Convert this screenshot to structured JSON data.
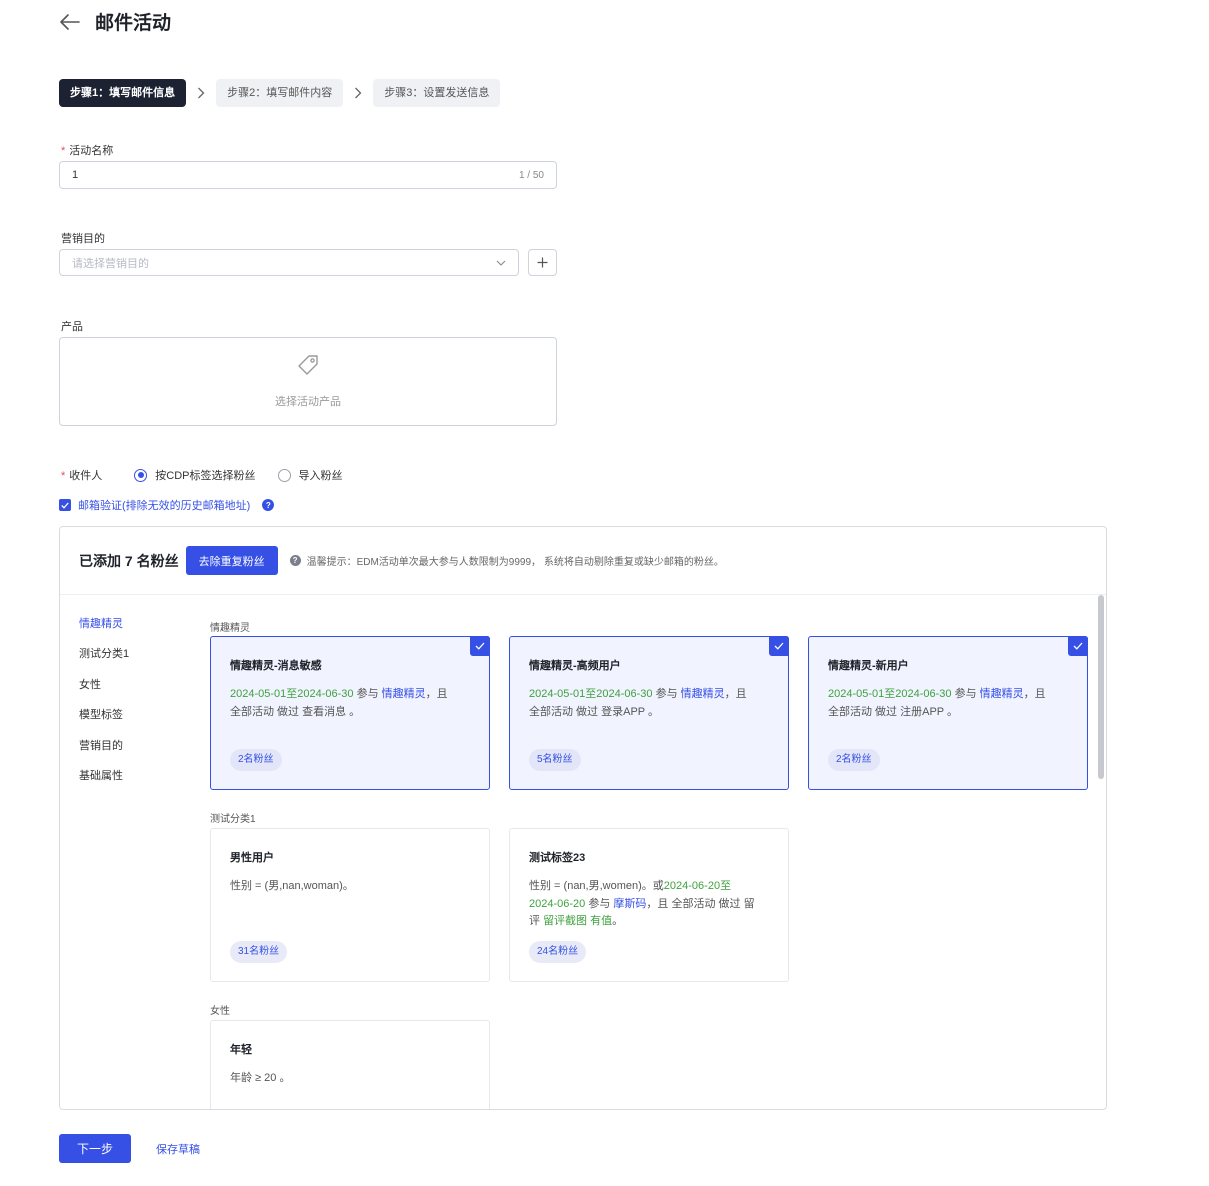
{
  "header": {
    "title": "邮件活动"
  },
  "steps": [
    {
      "label": "步骤1：填写邮件信息"
    },
    {
      "label": "步骤2：填写邮件内容"
    },
    {
      "label": "步骤3：设置发送信息"
    }
  ],
  "form": {
    "name_label": "活动名称",
    "name_value": "1",
    "name_count": "1 / 50",
    "purpose_label": "营销目的",
    "purpose_placeholder": "请选择营销目的",
    "product_label": "产品",
    "product_placeholder": "选择活动产品",
    "recipient_label": "收件人",
    "recipient_options": [
      "按CDP标签选择粉丝",
      "导入粉丝"
    ],
    "verify_label": "邮箱验证(排除无效的历史邮箱地址)"
  },
  "panel": {
    "added_text": "已添加 7 名粉丝",
    "dedupe_label": "去除重复粉丝",
    "tip": "温馨提示：EDM活动单次最大参与人数限制为9999， 系统将自动剔除重复或缺少邮箱的粉丝。",
    "nav": [
      "情趣精灵",
      "测试分类1",
      "女性",
      "模型标签",
      "营销目的",
      "基础属性"
    ],
    "groups": [
      {
        "title": "情趣精灵",
        "cards": [
          {
            "title": "情趣精灵-消息敏感",
            "date_range": "2024-05-01至2024-06-30",
            "t1": " 参与 ",
            "brand": "情趣精灵",
            "t2": "，且",
            "line2": "全部活动 做过 查看消息 。",
            "badge": "2名粉丝"
          },
          {
            "title": "情趣精灵-高频用户",
            "date_range": "2024-05-01至2024-06-30",
            "t1": " 参与 ",
            "brand": "情趣精灵",
            "t2": "，且",
            "line2": "全部活动 做过 登录APP 。",
            "badge": "5名粉丝"
          },
          {
            "title": "情趣精灵-新用户",
            "date_range": "2024-05-01至2024-06-30",
            "t1": " 参与 ",
            "brand": "情趣精灵",
            "t2": "，且",
            "line2": "全部活动 做过 注册APP 。",
            "badge": "2名粉丝"
          }
        ]
      },
      {
        "title": "测试分类1",
        "cards": [
          {
            "title": "男性用户",
            "desc": "性别 = (男,nan,woman)。",
            "badge": "31名粉丝"
          },
          {
            "title": "测试标签23",
            "d1": "性别 = (nan,男,women)。或",
            "d2": "2024-06-20至",
            "d3": "2024-06-20",
            "d4": " 参与 ",
            "d5": "摩斯码",
            "d6": "，且 全部活动 做过 留",
            "d7": "评 ",
            "d8": "留评截图 有值",
            "d9": "。",
            "badge": "24名粉丝"
          }
        ]
      },
      {
        "title": "女性",
        "cards": [
          {
            "title": "年轻",
            "desc": "年龄 ≥ 20 。"
          }
        ]
      }
    ]
  },
  "footer": {
    "next_label": "下一步",
    "draft_label": "保存草稿"
  },
  "colors": {
    "primary": "#3650e6",
    "dark_step": "#1d2233",
    "green_text": "#3fa13f"
  },
  "icons": [
    "back-arrow-icon",
    "chevron-right-icon",
    "chevron-down-icon",
    "plus-icon",
    "tag-icon",
    "check-icon",
    "help-icon",
    "info-icon"
  ]
}
